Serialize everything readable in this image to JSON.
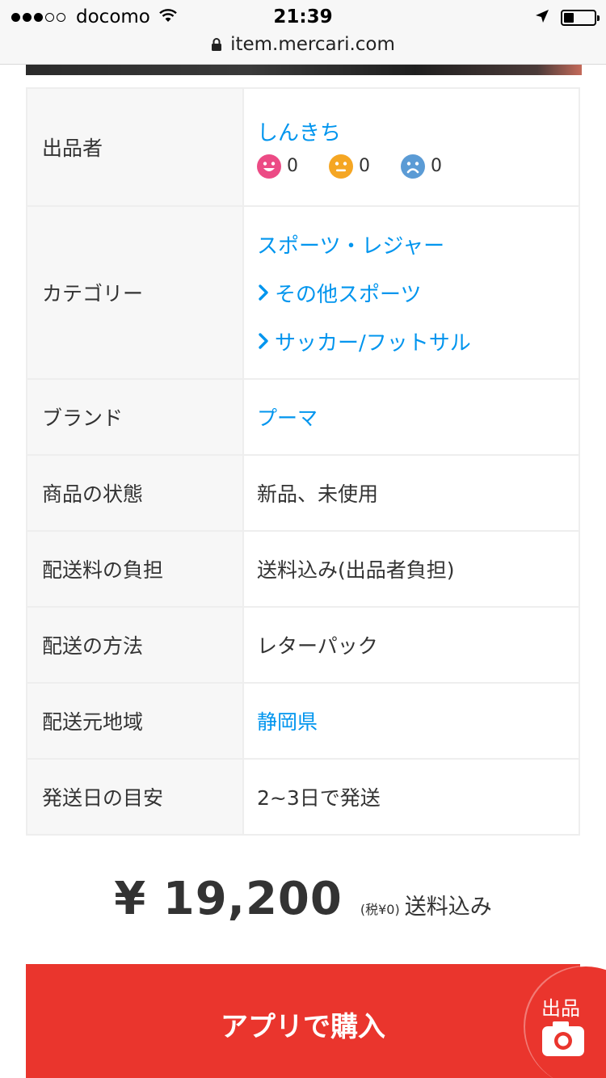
{
  "status_bar": {
    "carrier": "docomo",
    "time": "21:39"
  },
  "url_bar": {
    "domain": "item.mercari.com"
  },
  "details": {
    "seller": {
      "label": "出品者",
      "name": "しんきち",
      "ratings": {
        "good": "0",
        "normal": "0",
        "bad": "0"
      }
    },
    "category": {
      "label": "カテゴリー",
      "levels": [
        "スポーツ・レジャー",
        "その他スポーツ",
        "サッカー/フットサル"
      ]
    },
    "brand": {
      "label": "ブランド",
      "value": "プーマ"
    },
    "condition": {
      "label": "商品の状態",
      "value": "新品、未使用"
    },
    "shipping_fee": {
      "label": "配送料の負担",
      "value": "送料込み(出品者負担)"
    },
    "shipping_method": {
      "label": "配送の方法",
      "value": "レターパック"
    },
    "ship_from": {
      "label": "配送元地域",
      "value": "静岡県"
    },
    "ship_days": {
      "label": "発送日の目安",
      "value": "2~3日で発送"
    }
  },
  "price": {
    "amount": "¥ 19,200",
    "tax": "(税¥0)",
    "shipping": "送料込み"
  },
  "buy_button": {
    "label": "アプリで購入"
  },
  "sell_button": {
    "label": "出品"
  },
  "colors": {
    "accent": "#ea352d",
    "link": "#0095ee",
    "rating_good": "#ec4b85",
    "rating_normal": "#f5a623",
    "rating_bad": "#5b9bd5"
  }
}
